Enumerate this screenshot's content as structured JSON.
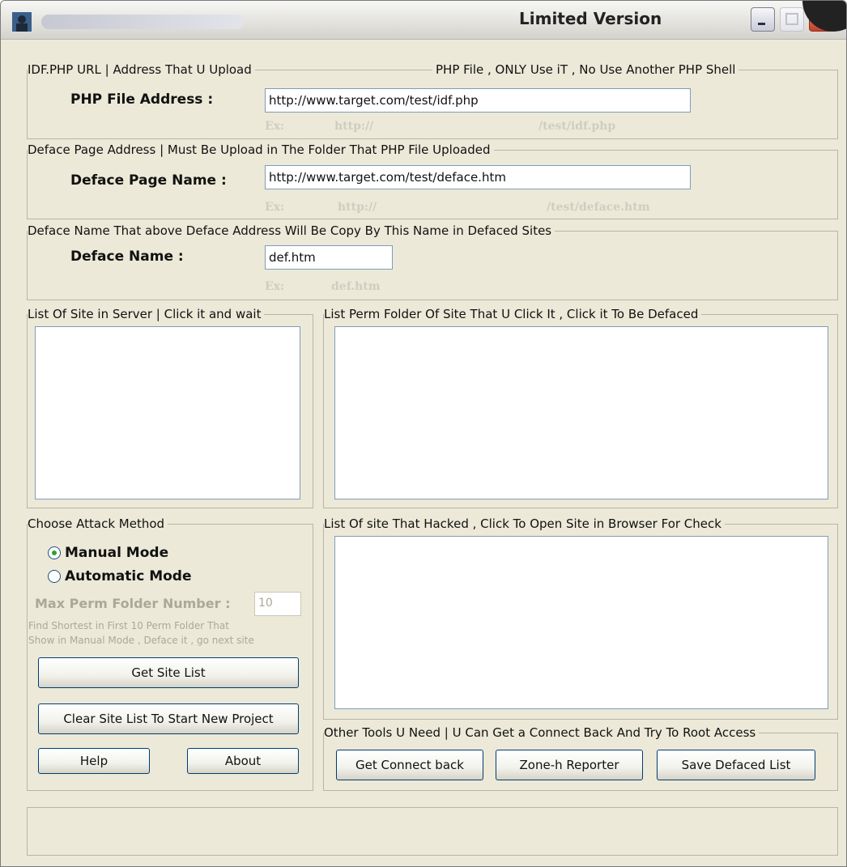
{
  "window": {
    "title": "Limited Version"
  },
  "php_group": {
    "legend": "IDF.PHP URL  |  Address That U Upload",
    "legend_right": "PHP File  , ONLY Use iT , No Use Another PHP Shell",
    "label": "PHP File Address :",
    "value": "http://www.target.com/test/idf.php",
    "example_prefix": "Ex:",
    "example_mid": "http://",
    "example_suffix": "/test/idf.php"
  },
  "deface_page_group": {
    "legend": "Deface Page Address |  Must Be Upload in The Folder That PHP File Uploaded",
    "label": "Deface Page Name :",
    "value": "http://www.target.com/test/deface.htm",
    "example_prefix": "Ex:",
    "example_mid": "http://",
    "example_suffix": "/test/deface.htm"
  },
  "deface_name_group": {
    "legend": "Deface Name That above Deface Address Will Be Copy By This Name in Defaced Sites",
    "label": "Deface Name :",
    "value": "def.htm",
    "example_prefix": "Ex:",
    "example_value": "def.htm"
  },
  "site_list": {
    "legend": "List Of Site in Server | Click it and wait"
  },
  "perm_folder_list": {
    "legend": "List Perm Folder Of Site That U Click It ,       Click it To Be Defaced"
  },
  "attack_method": {
    "legend": "Choose Attack Method",
    "manual_label": "Manual Mode",
    "automatic_label": "Automatic Mode",
    "selected": "Manual Mode",
    "max_perm_label": "Max Perm Folder Number :",
    "max_perm_value": "10",
    "note_line1": "Find Shortest in First 10 Perm Folder That",
    "note_line2": "Show in Manual Mode , Deface it , go next site",
    "get_site_list": "Get Site List",
    "clear_site_list": "Clear Site List To Start New Project",
    "help": "Help",
    "about": "About"
  },
  "hacked_list": {
    "legend": "List Of site That Hacked  , Click To Open Site in Browser For Check"
  },
  "other_tools": {
    "legend": "Other Tools U Need  | U Can Get a Connect Back And Try To Root Access",
    "connect_back": "Get Connect back",
    "zoneh": "Zone-h Reporter",
    "save_defaced": "Save Defaced List"
  },
  "colors": {
    "window_bg": "#ECE9D8",
    "input_border": "#7f9db9",
    "close_button": "#c6402a",
    "disabled_text": "#aca899"
  },
  "icons": [
    "app-icon",
    "minimize-icon",
    "maximize-icon",
    "close-icon"
  ]
}
